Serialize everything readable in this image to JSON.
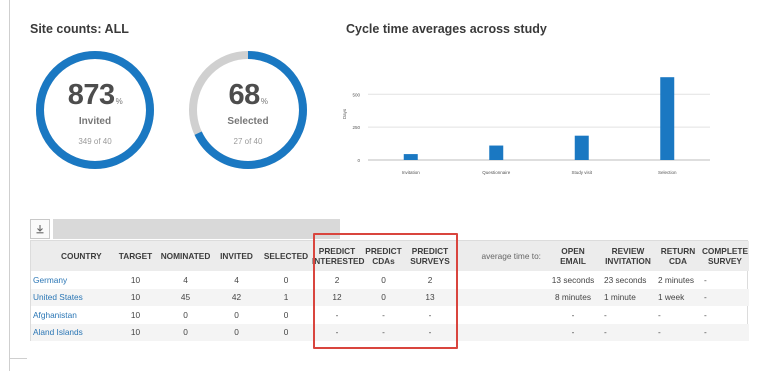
{
  "site_counts": {
    "title": "Site counts: ALL",
    "gauges": [
      {
        "value": "873",
        "unit": "%",
        "label": "Invited",
        "sub": "349 of 40",
        "fill_fraction": 1.0,
        "color": "#1a78c2"
      },
      {
        "value": "68",
        "unit": "%",
        "label": "Selected",
        "sub": "27 of 40",
        "fill_fraction": 0.68,
        "color": "#1a78c2"
      }
    ]
  },
  "cycle_chart": {
    "title": "Cycle time averages across study"
  },
  "chart_data": {
    "type": "bar",
    "title": "Cycle time averages across study",
    "categories": [
      "Invitation",
      "Questionnaire",
      "Study visit",
      "Selection"
    ],
    "values": [
      45,
      110,
      185,
      630
    ],
    "ylabel": "Days",
    "yticks": [
      0,
      250,
      500
    ],
    "ylim": [
      0,
      700
    ],
    "grid": true,
    "color": "#1a78c2"
  },
  "table": {
    "download_icon": "download-icon",
    "headers": {
      "country": "COUNTRY",
      "target": "TARGET",
      "nominated": "NOMINATED",
      "invited": "INVITED",
      "selected": "SELECTED",
      "predict_interested_1": "PREDICT",
      "predict_interested_2": "INTERESTED",
      "predict_cdas_1": "PREDICT",
      "predict_cdas_2": "CDAs",
      "predict_surveys_1": "PREDICT",
      "predict_surveys_2": "SURVEYS",
      "average_time": "average time to:",
      "open_email_1": "OPEN",
      "open_email_2": "EMAIL",
      "review_invitation_1": "REVIEW",
      "review_invitation_2": "INVITATION",
      "return_cda_1": "RETURN",
      "return_cda_2": "CDA",
      "complete_survey_1": "COMPLETE",
      "complete_survey_2": "SURVEY"
    },
    "rows": [
      {
        "country": "Germany",
        "target": "10",
        "nominated": "4",
        "invited": "4",
        "selected": "0",
        "predict_interested": "2",
        "predict_cdas": "0",
        "predict_surveys": "2",
        "open_email": "13 seconds",
        "review_invitation": "23 seconds",
        "return_cda": "2 minutes",
        "complete_survey": "-"
      },
      {
        "country": "United States",
        "target": "10",
        "nominated": "45",
        "invited": "42",
        "selected": "1",
        "predict_interested": "12",
        "predict_cdas": "0",
        "predict_surveys": "13",
        "open_email": "8 minutes",
        "review_invitation": "1 minute",
        "return_cda": "1 week",
        "complete_survey": "-"
      },
      {
        "country": "Afghanistan",
        "target": "10",
        "nominated": "0",
        "invited": "0",
        "selected": "0",
        "predict_interested": "-",
        "predict_cdas": "-",
        "predict_surveys": "-",
        "open_email": "-",
        "review_invitation": "-",
        "return_cda": "-",
        "complete_survey": "-"
      },
      {
        "country": "Aland Islands",
        "target": "10",
        "nominated": "0",
        "invited": "0",
        "selected": "0",
        "predict_interested": "-",
        "predict_cdas": "-",
        "predict_surveys": "-",
        "open_email": "-",
        "review_invitation": "-",
        "return_cda": "-",
        "complete_survey": "-"
      }
    ]
  },
  "highlight_color": "#d9453e"
}
